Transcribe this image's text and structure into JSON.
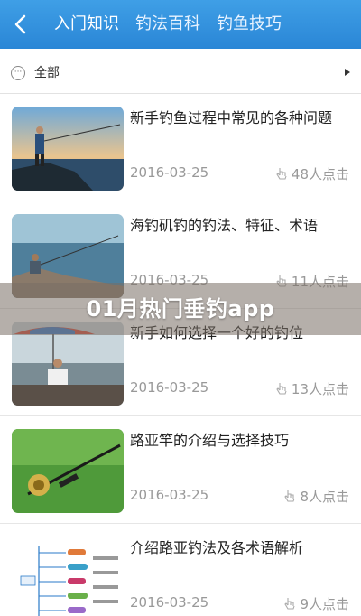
{
  "header": {
    "back_icon": "back-chevron-icon",
    "tabs": [
      {
        "label": "入门知识",
        "active": true
      },
      {
        "label": "钓法百科",
        "active": false
      },
      {
        "label": "钓鱼技巧",
        "active": false
      }
    ],
    "bg_color": "#2f8fdc"
  },
  "filter": {
    "label": "全部",
    "icon": "more-circle-icon",
    "arrow_icon": "arrow-right-icon"
  },
  "articles": [
    {
      "title": "新手钓鱼过程中常见的各种问题",
      "date": "2016-03-25",
      "clicks": "48人点击",
      "thumb": "man-fishing-on-rocks"
    },
    {
      "title": "海钓矶钓的钓法、特征、术语",
      "date": "2016-03-25",
      "clicks": "11人点击",
      "thumb": "angler-seated-by-sea"
    },
    {
      "title": "新手如何选择一个好的钓位",
      "date": "2016-03-25",
      "clicks": "13人点击",
      "thumb": "umbrella-on-pier"
    },
    {
      "title": "路亚竿的介绍与选择技巧",
      "date": "2016-03-25",
      "clicks": "8人点击",
      "thumb": "reel-on-grass"
    },
    {
      "title": "介绍路亚钓法及各术语解析",
      "date": "2016-03-25",
      "clicks": "9人点击",
      "thumb": "lure-diagram"
    }
  ],
  "banner": {
    "text": "01月热门垂钓app"
  },
  "colors": {
    "accent": "#2f8fdc",
    "muted_text": "#999999"
  }
}
